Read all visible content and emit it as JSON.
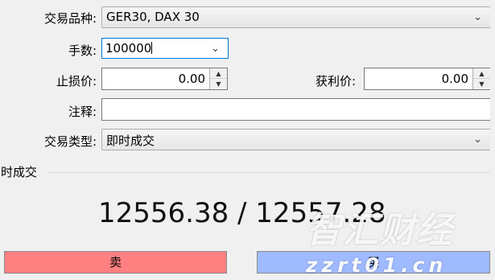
{
  "form": {
    "symbol": {
      "label": "交易品种:",
      "value": "GER30, DAX 30"
    },
    "volume": {
      "label": "手数:",
      "value": "100000"
    },
    "stop_loss": {
      "label": "止损价:",
      "value": "0.00"
    },
    "take_profit": {
      "label": "获利价:",
      "value": "0.00"
    },
    "comment": {
      "label": "注释:",
      "value": ""
    },
    "order_type": {
      "label": "交易类型:",
      "value": "即时成交"
    }
  },
  "section": {
    "title": "即时成交"
  },
  "quote": {
    "text": "12556.38 / 12557.28"
  },
  "buttons": {
    "sell": "卖",
    "buy": "买"
  },
  "watermark": {
    "brand": "智汇财经",
    "url": "zzrt01.cn"
  },
  "colors": {
    "sell": "#ff8080",
    "buy": "#9fbaff",
    "focus_border": "#0078d7"
  },
  "icons": {
    "dropdown": "chevron-down-icon",
    "spin_up": "spin-up-icon",
    "spin_down": "spin-down-icon"
  }
}
